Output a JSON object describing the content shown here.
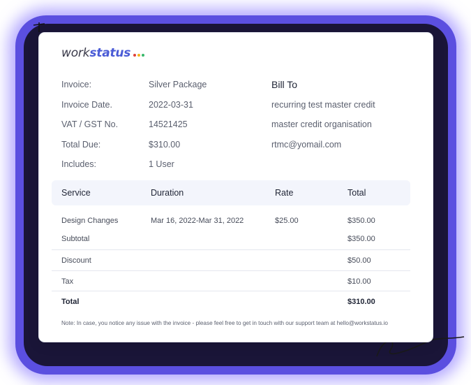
{
  "brand": {
    "name_prefix": "work",
    "name_suffix": "status",
    "dot_colors": [
      "#e0413a",
      "#f3b21b",
      "#37b86a"
    ]
  },
  "invoice_info": [
    {
      "label": "Invoice:",
      "value": "Silver Package"
    },
    {
      "label": "Invoice Date.",
      "value": "2022-03-31"
    },
    {
      "label": "VAT / GST No.",
      "value": "14521425"
    },
    {
      "label": "Total Due:",
      "value": "$310.00"
    },
    {
      "label": "Includes:",
      "value": "1 User"
    }
  ],
  "bill_to": {
    "title": "Bill To",
    "lines": [
      "recurring test master credit",
      "master credit organisation",
      "rtmc@yomail.com"
    ]
  },
  "table": {
    "headers": [
      "Service",
      "Duration",
      "Rate",
      "Total"
    ],
    "rows": [
      {
        "service": "Design Changes",
        "duration": "Mar 16, 2022-Mar 31, 2022",
        "rate": "$25.00",
        "total": "$350.00"
      }
    ]
  },
  "summary": [
    {
      "label": "Subtotal",
      "value": "$350.00"
    },
    {
      "label": "Discount",
      "value": "$50.00"
    },
    {
      "label": "Tax",
      "value": "$10.00"
    },
    {
      "label": "Total",
      "value": "$310.00"
    }
  ],
  "note": "Note: In case, you notice any issue with the invoice - please feel free to get in touch with our support team at hello@workstatus.io"
}
